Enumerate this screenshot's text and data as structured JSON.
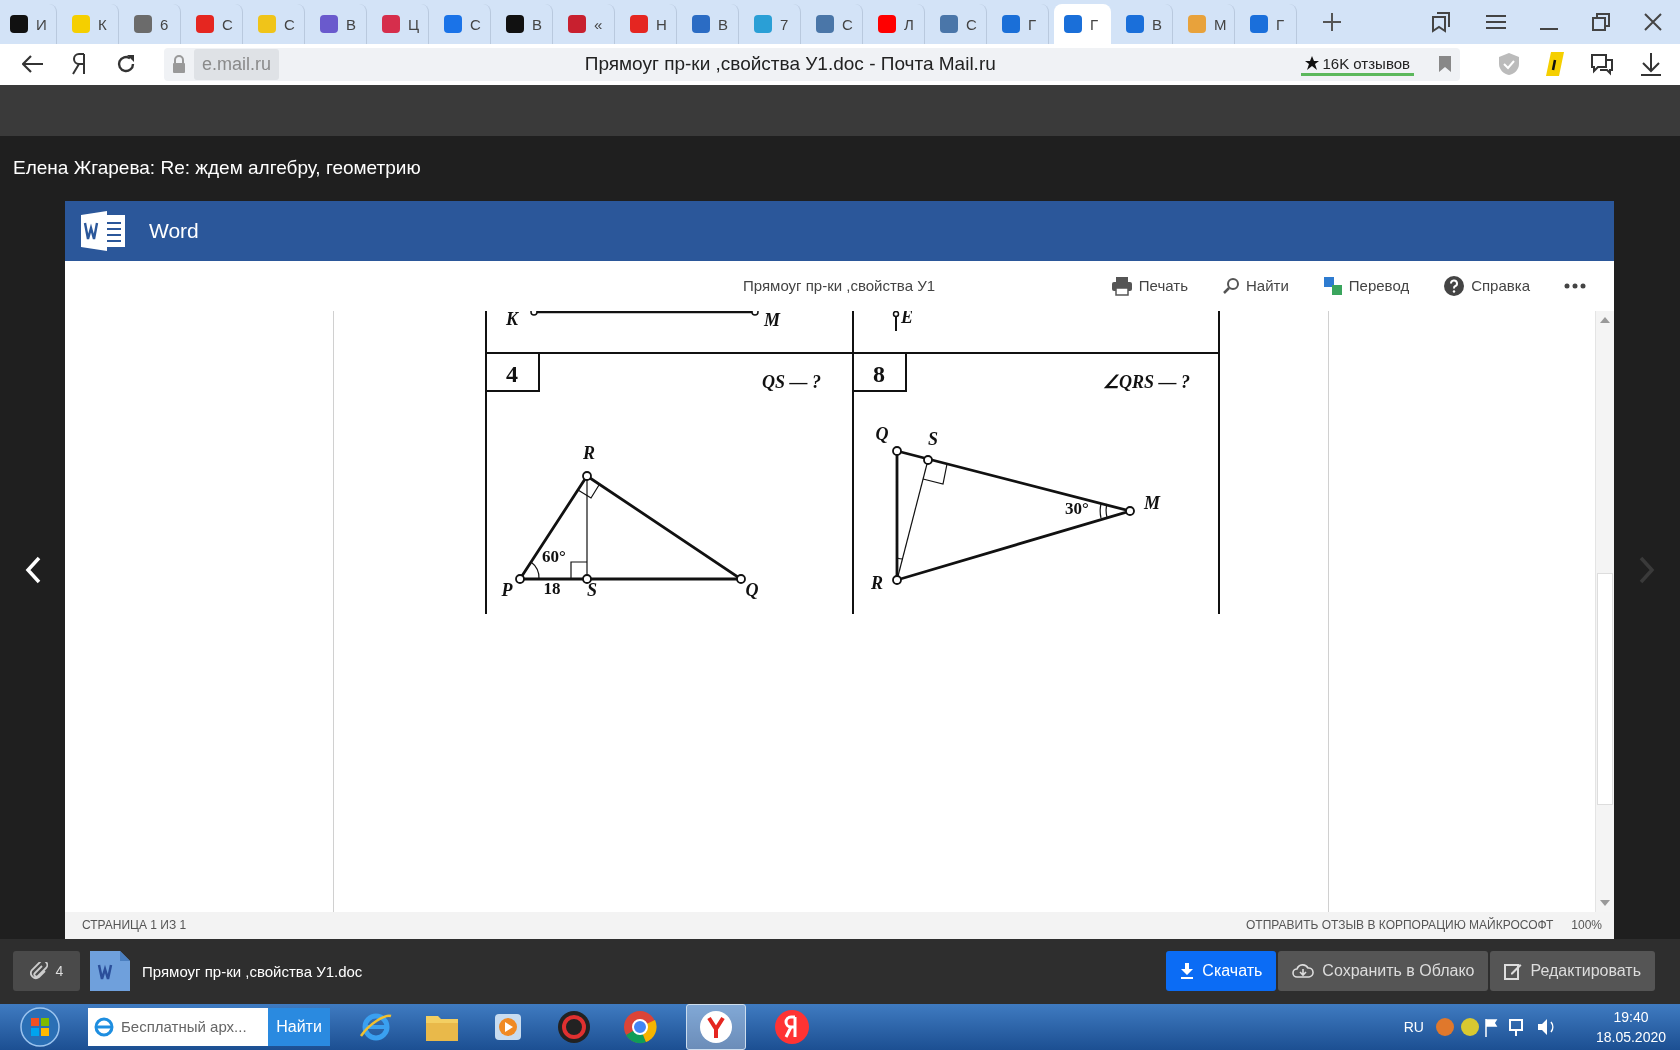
{
  "browser": {
    "tabs": [
      {
        "letter": "И",
        "color": "#111111",
        "selected": false
      },
      {
        "letter": "К",
        "color": "#f5cf00",
        "selected": false
      },
      {
        "letter": "6",
        "color": "#6b6b6b",
        "selected": false
      },
      {
        "letter": "С",
        "color": "#e52620",
        "selected": false
      },
      {
        "letter": "С",
        "color": "#f0c419",
        "selected": false
      },
      {
        "letter": "В",
        "color": "#6a5acd",
        "selected": false
      },
      {
        "letter": "Ц",
        "color": "#d62e4c",
        "selected": false
      },
      {
        "letter": "С",
        "color": "#1a73e8",
        "selected": false
      },
      {
        "letter": "В",
        "color": "#111111",
        "selected": false
      },
      {
        "letter": "«",
        "color": "#c8202f",
        "selected": false
      },
      {
        "letter": "Н",
        "color": "#e52621",
        "selected": false
      },
      {
        "letter": "В",
        "color": "#2b6cc4",
        "selected": false
      },
      {
        "letter": "7",
        "color": "#2a9fd6",
        "selected": false
      },
      {
        "letter": "С",
        "color": "#4a76a8",
        "selected": false
      },
      {
        "letter": "Л",
        "color": "#ff0000",
        "selected": false
      },
      {
        "letter": "С",
        "color": "#4a76a9",
        "selected": false
      },
      {
        "letter": "Г",
        "color": "#1a6fd8",
        "selected": false
      },
      {
        "letter": "Г",
        "color": "#1a6fd9",
        "selected": true
      },
      {
        "letter": "В",
        "color": "#1a6fda",
        "selected": false
      },
      {
        "letter": "М",
        "color": "#e8a23b",
        "selected": false
      },
      {
        "letter": "Г",
        "color": "#1a6fdb",
        "selected": false
      }
    ],
    "address": "e.mail.ru",
    "page_title": "Прямоуг пр-ки ,свойства У1.doc - Почта Mail.ru",
    "reviews": "16K отзывов"
  },
  "mail": {
    "subject": "Елена Жгарева: Re: ждем алгебру, геометрию"
  },
  "word": {
    "app_name": "Word",
    "doc_title": "Прямоуг пр-ки ,свойства У1",
    "toolbar": [
      {
        "label": "Печать",
        "kind": "print"
      },
      {
        "label": "Найти",
        "kind": "find"
      },
      {
        "label": "Перевод",
        "kind": "translate"
      },
      {
        "label": "Справка",
        "kind": "help"
      }
    ],
    "document": {
      "top_labels": [
        "K",
        "M",
        "E"
      ],
      "problems": [
        {
          "number": "4",
          "question": "QS — ?",
          "labels": [
            "R",
            "60°",
            "P",
            "18",
            "S",
            "Q"
          ]
        },
        {
          "number": "8",
          "question": "∠QRS — ?",
          "labels": [
            "Q",
            "S",
            "30°",
            "M",
            "R"
          ]
        }
      ]
    },
    "status_page": "СТРАНИЦА 1 ИЗ 1",
    "status_feedback": "ОТПРАВИТЬ ОТЗЫВ В КОРПОРАЦИЮ МАЙКРОСОФТ",
    "zoom": "100%"
  },
  "attachments": {
    "count": "4",
    "file_name": "Прямоуг пр-ки ,свойства У1.doc",
    "buttons": [
      {
        "label": "Скачать",
        "kind": "download"
      },
      {
        "label": "Сохранить в Облако",
        "kind": "cloud"
      },
      {
        "label": "Редактировать",
        "kind": "edit"
      }
    ]
  },
  "taskbar": {
    "search_value": "Бесплатный арх...",
    "search_button": "Найти",
    "language": "RU",
    "time": "19:40",
    "date": "18.05.2020"
  }
}
